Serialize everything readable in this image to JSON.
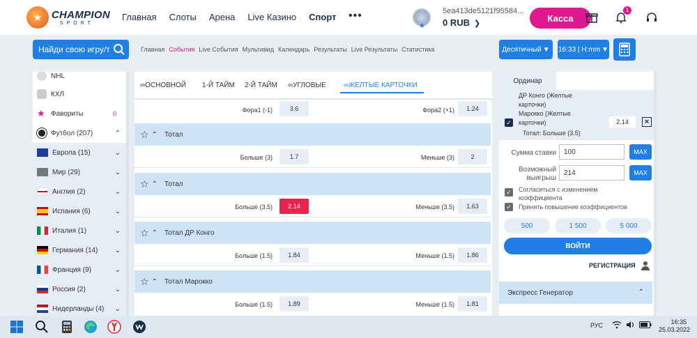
{
  "header": {
    "logo_main": "CHAMPION",
    "logo_sub": "SPORT",
    "nav": [
      "Главная",
      "Слоты",
      "Арена",
      "Live Казино",
      "Спорт"
    ],
    "more": "•••",
    "account_id": "5ea413de5121f95584...",
    "balance": "0 RUB",
    "kassa": "Касса",
    "notifications": "1"
  },
  "subbar": {
    "search_placeholder": "Найди свою игру/т",
    "nav": [
      "Главная",
      "События",
      "Live События",
      "Мультивид",
      "Календарь",
      "Результаты",
      "Live Результаты",
      "Статистика"
    ],
    "active_nav": "События",
    "odds_format": "Десятичный",
    "time_format": "16:33 | H:mm"
  },
  "sidebar": {
    "items": [
      {
        "label": "NHL",
        "icon": "nhl-icon"
      },
      {
        "label": "КХЛ",
        "icon": "khl-icon"
      },
      {
        "label": "Фавориты",
        "count": "0",
        "icon": "star-icon"
      },
      {
        "label": "Футбол (207)",
        "icon": "football-icon"
      },
      {
        "label": "Европа (15)",
        "icon": "flag-eu"
      },
      {
        "label": "Мир (29)",
        "icon": "flag-world"
      },
      {
        "label": "Англия (2)",
        "icon": "flag-england"
      },
      {
        "label": "Испания (6)",
        "icon": "flag-spain"
      },
      {
        "label": "Италия (1)",
        "icon": "flag-italy"
      },
      {
        "label": "Германия (14)",
        "icon": "flag-germany"
      },
      {
        "label": "Франция (9)",
        "icon": "flag-france"
      },
      {
        "label": "Россия (2)",
        "icon": "flag-russia"
      },
      {
        "label": "Нидерланды (4)",
        "icon": "flag-netherlands"
      }
    ]
  },
  "markets": {
    "tabs": [
      "ОСНОВНОЙ",
      "1-Й ТАЙМ",
      "2-Й ТАЙМ",
      "УГЛОВЫЕ",
      "ЖЕЛТЫЕ КАРТОЧКИ"
    ],
    "active_tab": "ЖЕЛТЫЕ КАРТОЧКИ",
    "top_row": {
      "left_label": "Фора1 (-1)",
      "left_odd": "3.6",
      "right_label": "Фора2 (+1)",
      "right_odd": "1.24"
    },
    "groups": [
      {
        "title": "Тотал",
        "left_label": "Больше (3)",
        "left_odd": "1.7",
        "right_label": "Меньше (3)",
        "right_odd": "2"
      },
      {
        "title": "Тотал",
        "left_label": "Больше (3.5)",
        "left_odd": "2.14",
        "right_label": "Меньше (3.5)",
        "right_odd": "1.63",
        "selected": "left"
      },
      {
        "title": "Тотал ДР Конго",
        "left_label": "Больше (1.5)",
        "left_odd": "1.84",
        "right_label": "Меньше (1.5)",
        "right_odd": "1.86"
      },
      {
        "title": "Тотал Марокко",
        "left_label": "Больше (1.5)",
        "left_odd": "1.89",
        "right_label": "Меньше (1.5)",
        "right_odd": "1.81"
      }
    ]
  },
  "betslip": {
    "tab": "Ординар",
    "bet_lines": [
      "ДР Конго (Желтые",
      "карточки)",
      "Марокко (Желтые",
      "карточки)"
    ],
    "bet_odd": "2.14",
    "bet_market": "Тотал: Больше (3.5)",
    "stake_label": "Сумма ставки",
    "stake_value": "100",
    "win_label_1": "Возможный",
    "win_label_2": "выигрыш",
    "win_value": "214",
    "max": "MAX",
    "accept_change_1": "Согласиться с изменением",
    "accept_change_2": "коэффициента",
    "accept_raise": "Принять повышение коэффициентов",
    "quick": [
      "500",
      "1 500",
      "5 000"
    ],
    "login": "ВОЙТИ",
    "register": "РЕГИСТРАЦИЯ",
    "express": "Экспресс Генератор"
  },
  "taskbar": {
    "lang": "РУС",
    "time": "16:35",
    "date": "25.03.2022"
  }
}
